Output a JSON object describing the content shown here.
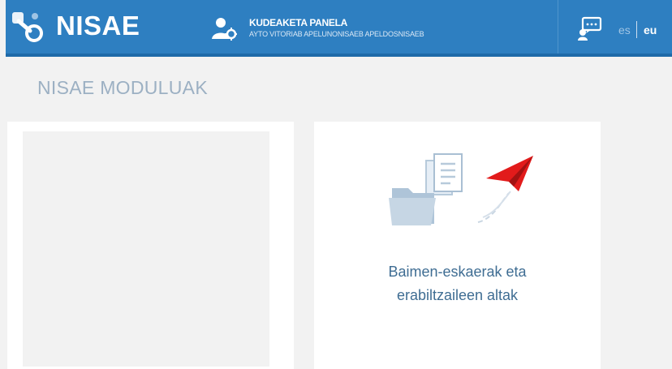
{
  "header": {
    "brand": "NISAE",
    "panel_title": "KUDEAKETA PANELA",
    "panel_subtitle": "AYTO VITORIAB APELUNONISAEB APELDOSNISAEB",
    "languages": {
      "es": "es",
      "eu": "eu"
    },
    "icons": {
      "brand": "nisae-logo-icon",
      "panel": "user-settings-icon",
      "chat": "support-chat-icon"
    },
    "colors": {
      "bar": "#2e7fc1",
      "active_lang": "#ffffff"
    }
  },
  "main": {
    "section_title": "NISAE MODULUAK",
    "modules": [
      {
        "label_line1": "",
        "label_line2": ""
      },
      {
        "label_line1": "Baimen-eskaerak eta",
        "label_line2": "erabiltzaileen altak",
        "icon": "documents-send-icon"
      }
    ]
  }
}
